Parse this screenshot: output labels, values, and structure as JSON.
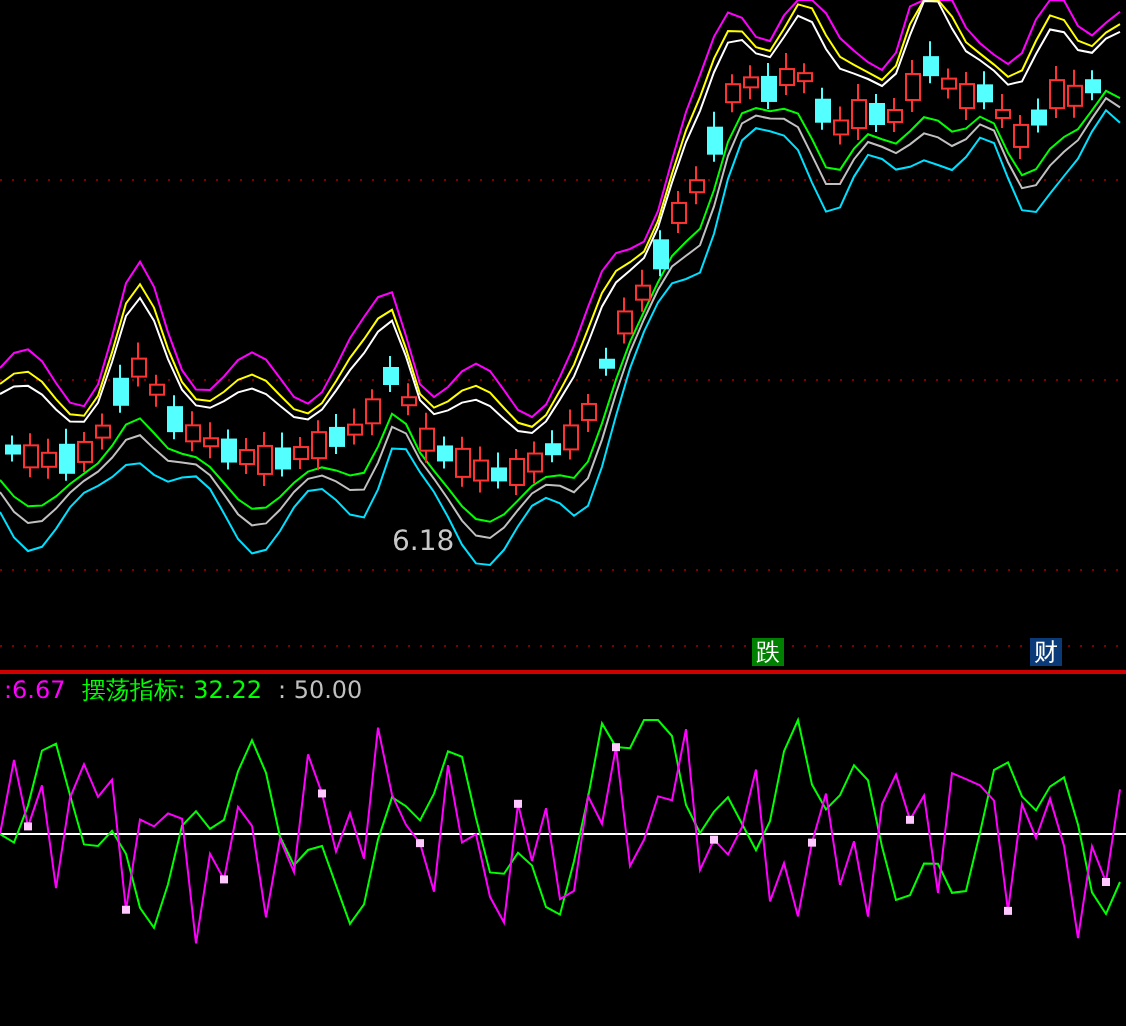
{
  "price_chart": {
    "price_label": "6.18",
    "badges": [
      {
        "text": "跌",
        "color": "#008000"
      },
      {
        "text": "财",
        "color": "#0a3a78"
      }
    ]
  },
  "indicator_legend": [
    {
      "text": ":6.67",
      "color": "#ff00ff"
    },
    {
      "text": "摆荡指标: 32.22",
      "color": "#00ff00"
    },
    {
      "text": ": 50.00",
      "color": "#c0c0c0"
    }
  ]
}
